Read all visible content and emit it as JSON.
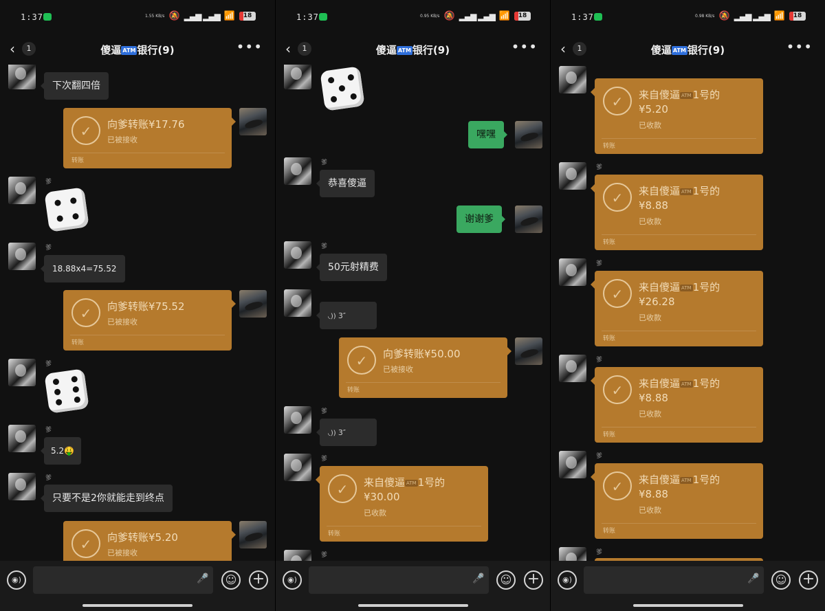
{
  "status_bar": {
    "time": "1:37",
    "battery": "18",
    "speeds": [
      "1.55 KB/s",
      "0.95 KB/s",
      "0.98 KB/s"
    ]
  },
  "chat": {
    "title": "傻逼",
    "title_chip": "ATM",
    "title_suffix": "银行(9)",
    "unread": "1"
  },
  "sender_name": "爹",
  "panel0": {
    "msg_1": "下次翻四倍",
    "transfer_1": {
      "title": "向爹转账¥17.76",
      "status": "已被接收",
      "footer": "转账"
    },
    "msg_2": "18.88x4=75.52",
    "transfer_2": {
      "title": "向爹转账¥75.52",
      "status": "已被接收",
      "footer": "转账"
    },
    "msg_3": "5.2🤑",
    "msg_4": "只要不是2你就能走到终点",
    "transfer_3": {
      "title": "向爹转账¥5.20",
      "status": "已被接收"
    }
  },
  "panel1": {
    "msg_me_1": "嘿嘿",
    "msg_1": "恭喜傻逼",
    "msg_me_2": "谢谢爹",
    "msg_2": "50元射精费",
    "voice_1": "3″",
    "transfer_1": {
      "title": "向爹转账¥50.00",
      "status": "已被接收",
      "footer": "转账"
    },
    "voice_2": "3″",
    "transfer_2": {
      "title_prefix": "来自傻逼",
      "title_chip": "ATM",
      "title_suffix": "1号的",
      "amount": "¥30.00",
      "status": "已收款",
      "footer": "转账"
    }
  },
  "panel2": {
    "transfers": [
      {
        "title_prefix": "来自傻逼",
        "title_chip": "ATM",
        "title_suffix": "1号的",
        "amount": "¥5.20",
        "status": "已收款",
        "footer": "转账"
      },
      {
        "title_prefix": "来自傻逼",
        "title_chip": "ATM",
        "title_suffix": "1号的",
        "amount": "¥8.88",
        "status": "已收款",
        "footer": "转账"
      },
      {
        "title_prefix": "来自傻逼",
        "title_chip": "ATM",
        "title_suffix": "1号的",
        "amount": "¥26.28",
        "status": "已收款",
        "footer": "转账"
      },
      {
        "title_prefix": "来自傻逼",
        "title_chip": "ATM",
        "title_suffix": "1号的",
        "amount": "¥8.88",
        "status": "已收款",
        "footer": "转账"
      },
      {
        "title_prefix": "来自傻逼",
        "title_chip": "ATM",
        "title_suffix": "1号的",
        "amount": "¥8.88",
        "status": "已收款",
        "footer": "转账"
      }
    ]
  },
  "colors": {
    "transfer": "#b57a2d",
    "bubble_them": "#2c2c2c",
    "bubble_me": "#3aa860",
    "background": "#111111",
    "wechat": "#1fbf54"
  },
  "dice_values": {
    "panel0_dice_1": 4,
    "panel0_dice_2": 6,
    "panel1_dice_1": 5
  },
  "icons": [
    "back-arrow-icon",
    "more-icon",
    "check-icon",
    "voice-wave-icon",
    "mic-icon",
    "emoji-icon",
    "plus-icon",
    "wifi-icon",
    "mute-icon",
    "signal-icon",
    "battery-icon"
  ]
}
